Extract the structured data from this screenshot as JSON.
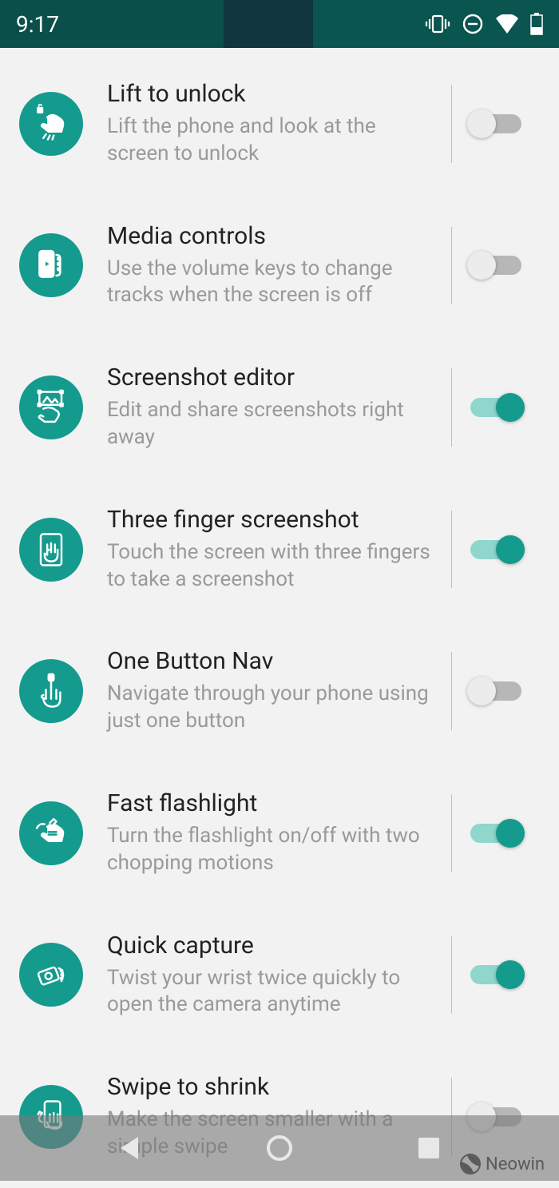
{
  "status": {
    "time": "9:17"
  },
  "settings": [
    {
      "id": "lift-to-unlock",
      "title": "Lift to unlock",
      "desc": "Lift the phone and look at the screen to unlock",
      "on": false,
      "icon": "lift-unlock-icon"
    },
    {
      "id": "media-controls",
      "title": "Media controls",
      "desc": "Use the volume keys to change tracks when the screen is off",
      "on": false,
      "icon": "media-controls-icon"
    },
    {
      "id": "screenshot-editor",
      "title": "Screenshot editor",
      "desc": "Edit and share screenshots right away",
      "on": true,
      "icon": "screenshot-editor-icon"
    },
    {
      "id": "three-finger-screenshot",
      "title": "Three finger screenshot",
      "desc": "Touch the screen with three fingers to take a screenshot",
      "on": true,
      "icon": "three-finger-icon"
    },
    {
      "id": "one-button-nav",
      "title": "One Button Nav",
      "desc": "Navigate through your phone using just one button",
      "on": false,
      "icon": "one-button-nav-icon"
    },
    {
      "id": "fast-flashlight",
      "title": "Fast flashlight",
      "desc": "Turn the flashlight on/off with two chopping motions",
      "on": true,
      "icon": "flashlight-icon"
    },
    {
      "id": "quick-capture",
      "title": "Quick capture",
      "desc": "Twist your wrist twice quickly to open the camera anytime",
      "on": true,
      "icon": "quick-capture-icon"
    },
    {
      "id": "swipe-to-shrink",
      "title": "Swipe to shrink",
      "desc": "Make the screen smaller with a simple swipe",
      "on": false,
      "icon": "swipe-shrink-icon"
    }
  ],
  "watermark": {
    "label": "Neowin"
  }
}
